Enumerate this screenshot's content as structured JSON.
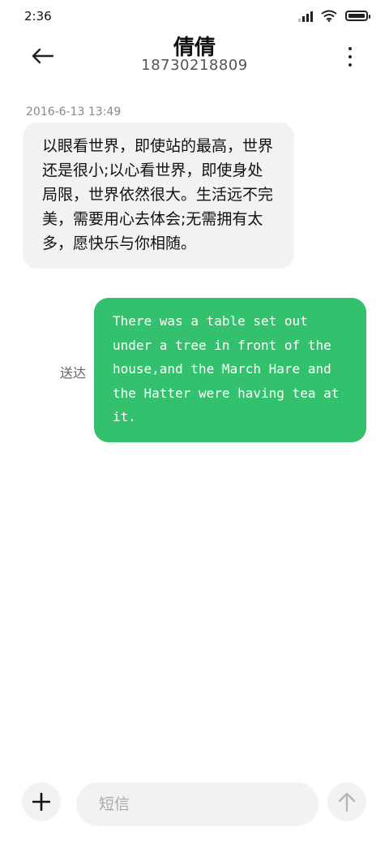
{
  "status_bar": {
    "time": "2:36",
    "icons": [
      "signal-icon",
      "wifi-icon",
      "battery-icon"
    ]
  },
  "header": {
    "contact_name": "倩倩",
    "contact_number": "18730218809",
    "icons": [
      "back-arrow-icon",
      "more-vertical-icon"
    ]
  },
  "thread": {
    "timestamp": "2016-6-13  13:49",
    "incoming_message": "以眼看世界，即使站的最高，世界还是很小;以心看世界，即使身处局限，世界依然很大。生活远不完美，需要用心去体会;无需拥有太多，愿快乐与你相随。",
    "outgoing_message": "There was a table set out under a tree in front of the house,and the March Hare and the Hatter were having tea at it.",
    "delivery_status": "送达"
  },
  "composer": {
    "placeholder": "短信",
    "icons": [
      "plus-icon",
      "send-arrow-icon"
    ]
  },
  "colors": {
    "outgoing_bubble": "#33c16e",
    "incoming_bubble": "#f2f2f2",
    "background": "#ffffff"
  }
}
